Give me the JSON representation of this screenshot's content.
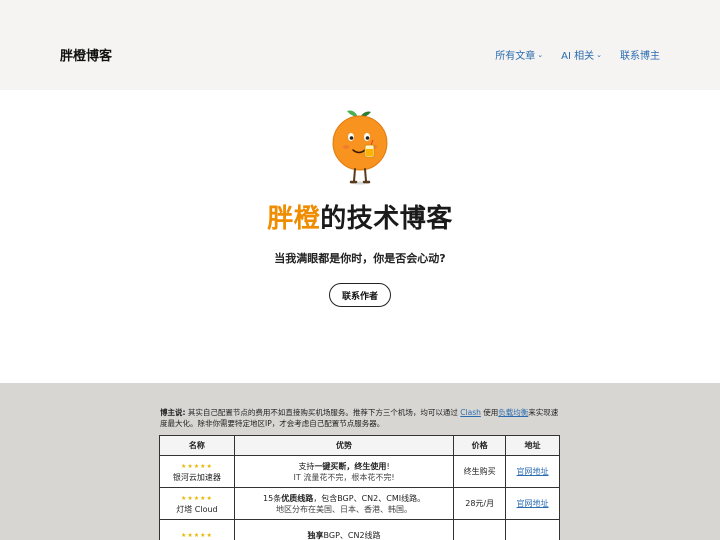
{
  "header": {
    "site_title": "胖橙博客",
    "nav": [
      {
        "label": "所有文章",
        "has_dropdown": true
      },
      {
        "label": "AI 相关",
        "has_dropdown": true
      },
      {
        "label": "联系博主",
        "has_dropdown": false
      }
    ]
  },
  "hero": {
    "title_accent": "胖橙",
    "title_rest": "的技术博客",
    "subtitle": "当我满眼都是你时，你是否会心动?",
    "button_label": "联系作者"
  },
  "note": {
    "label": "博主说:",
    "text_1": "其实自己配置节点的费用不如直接购买机场服务。推荐下方三个机场，均可以通过",
    "link_clash": "Clash",
    "text_2": "使用",
    "link_lb": "负载均衡",
    "text_3": "来实现速度最大化。除非你需要特定地区IP，才会考虑自己配置节点服务器。"
  },
  "table": {
    "headers": [
      "名称",
      "优势",
      "价格",
      "地址"
    ],
    "rows": [
      {
        "stars": "★★★★★",
        "name": "银河云加速器",
        "adv_pre": "支持",
        "adv_bold": "一键买断，终生使用",
        "adv_post": "!",
        "adv_line2": "IT 流量花不完，根本花不完!",
        "price": "终生购买",
        "link": "官网地址"
      },
      {
        "stars": "★★★★★",
        "name": "灯塔 Cloud",
        "adv_pre": "15条",
        "adv_bold": "优质线路",
        "adv_post": "，包含BGP、CN2、CMI线路。",
        "adv_line2": "地区分布在美国、日本、香港、韩国。",
        "price": "28元/月",
        "link": "官网地址"
      },
      {
        "stars": "★★★★★",
        "name": "",
        "adv_pre": "",
        "adv_bold": "独享",
        "adv_post": "BGP、CN2线路",
        "adv_line2": "",
        "price": "",
        "link": ""
      }
    ]
  },
  "colors": {
    "accent_orange": "#f08c00",
    "link_blue": "#2b6cb0",
    "header_bg": "#f5f4f2",
    "content_bg": "#d8d6d3"
  }
}
